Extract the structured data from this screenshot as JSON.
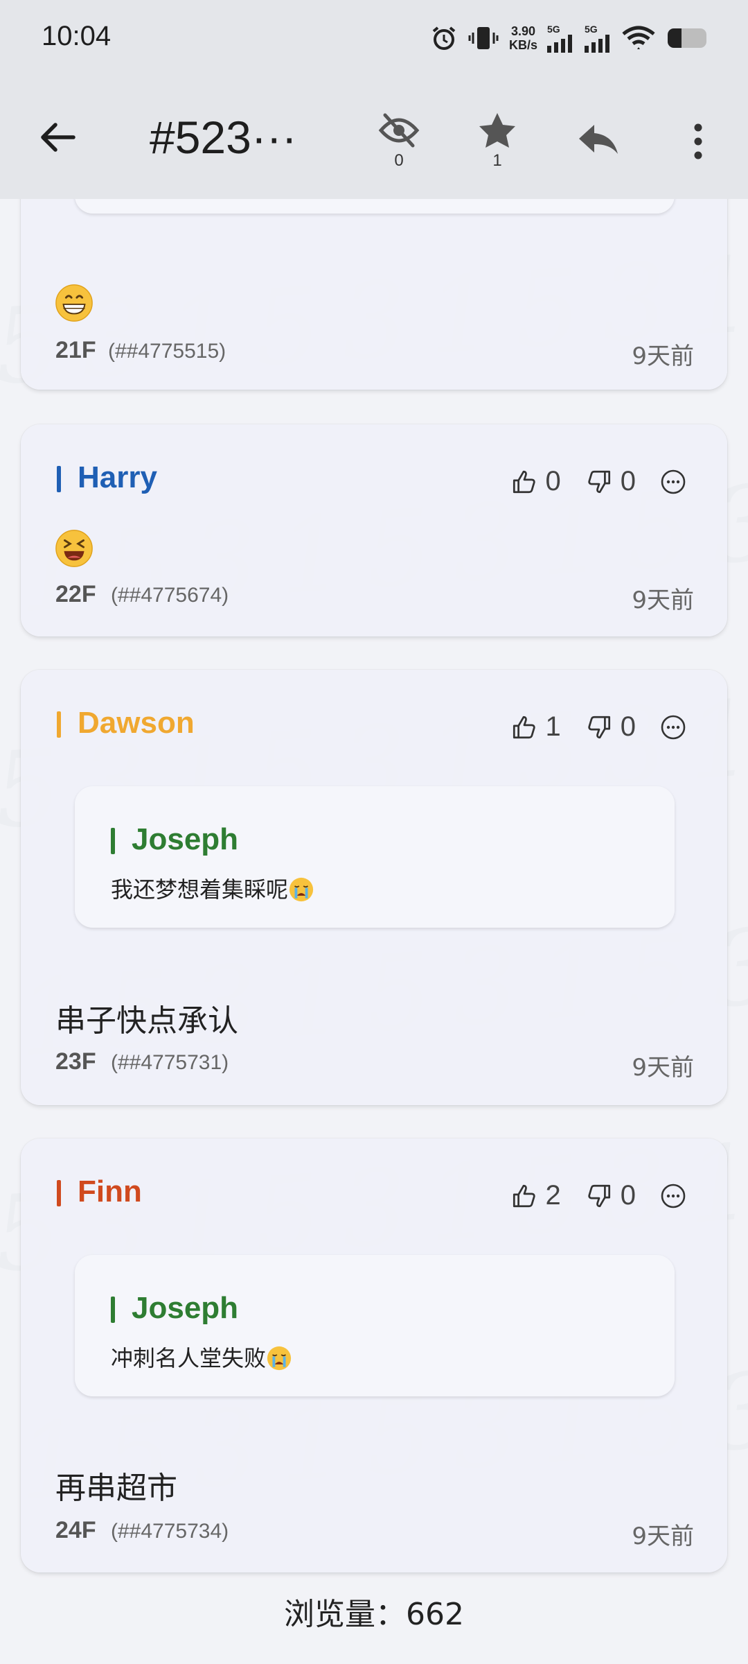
{
  "status_bar": {
    "time": "10:04",
    "net_speed_value": "3.90",
    "net_speed_unit": "KB/s",
    "sig1_label": "5G",
    "sig2_label": "5G"
  },
  "toolbar": {
    "title": "#523···",
    "hide_count": "0",
    "star_count": "1"
  },
  "posts": [
    {
      "floor": "21F",
      "floor_id": "(##4775515)",
      "time": "9天前",
      "emoji": "grin-face-icon"
    },
    {
      "author": "Harry",
      "author_color": "#1f5fb4",
      "likes": "0",
      "dislikes": "0",
      "floor": "22F",
      "floor_id": "(##4775674)",
      "time": "9天前",
      "emoji": "laughing-face-icon"
    },
    {
      "author": "Dawson",
      "author_color": "#f0a830",
      "likes": "1",
      "dislikes": "0",
      "quote_author": "Joseph",
      "quote_text": "我还梦想着集睬呢",
      "text": "串子快点承认",
      "floor": "23F",
      "floor_id": "(##4775731)",
      "time": "9天前"
    },
    {
      "author": "Finn",
      "author_color": "#d04a1e",
      "likes": "2",
      "dislikes": "0",
      "quote_author": "Joseph",
      "quote_text": "冲刺名人堂失败",
      "text": "再串超市",
      "floor": "24F",
      "floor_id": "(##4775734)",
      "time": "9天前"
    }
  ],
  "footer": {
    "views": "浏览量：662"
  },
  "watermark_text": "315315315315"
}
